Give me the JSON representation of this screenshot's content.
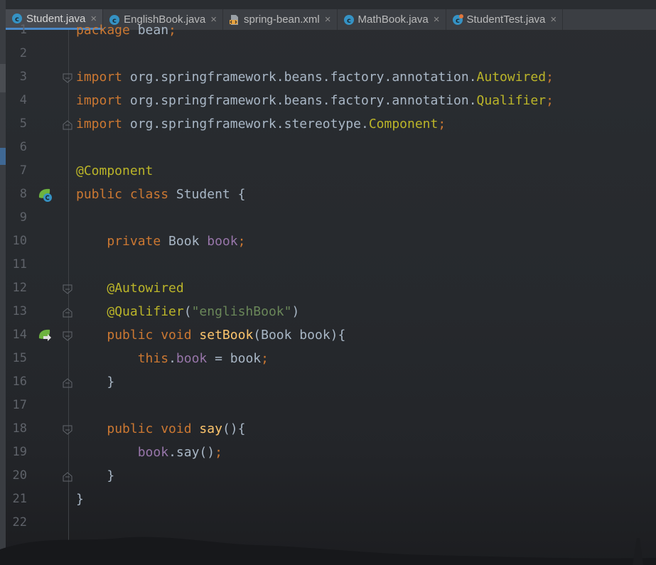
{
  "tabs": [
    {
      "label": "Student.java",
      "icon": "java-class-icon",
      "active": true
    },
    {
      "label": "EnglishBook.java",
      "icon": "java-class-icon",
      "active": false
    },
    {
      "label": "spring-bean.xml",
      "icon": "xml-file-icon",
      "active": false
    },
    {
      "label": "MathBook.java",
      "icon": "java-class-icon",
      "active": false
    },
    {
      "label": "StudentTest.java",
      "icon": "java-test-class-icon",
      "active": false
    }
  ],
  "close_glyph": "×",
  "colors": {
    "keyword": "#cc7832",
    "annotation": "#bbb529",
    "field": "#9876aa",
    "string": "#6a8759",
    "method": "#ffc66d",
    "plain": "#a9b7c6",
    "tab_active_underline": "#4a88c7"
  },
  "lines": [
    {
      "n": "1",
      "tokens": [
        [
          "kw",
          "package"
        ],
        [
          "pl",
          " bean"
        ],
        [
          "kw",
          ";"
        ]
      ]
    },
    {
      "n": "2",
      "tokens": []
    },
    {
      "n": "3",
      "tokens": [
        [
          "kw",
          "import"
        ],
        [
          "pl",
          " org.springframework.beans.factory.annotation."
        ],
        [
          "ann",
          "Autowired"
        ],
        [
          "kw",
          ";"
        ]
      ]
    },
    {
      "n": "4",
      "tokens": [
        [
          "kw",
          "import"
        ],
        [
          "pl",
          " org.springframework.beans.factory.annotation."
        ],
        [
          "ann",
          "Qualifier"
        ],
        [
          "kw",
          ";"
        ]
      ]
    },
    {
      "n": "5",
      "tokens": [
        [
          "kw",
          "import"
        ],
        [
          "pl",
          " org.springframework.stereotype."
        ],
        [
          "ann",
          "Component"
        ],
        [
          "kw",
          ";"
        ]
      ]
    },
    {
      "n": "6",
      "tokens": []
    },
    {
      "n": "7",
      "tokens": [
        [
          "ann",
          "@Component"
        ]
      ]
    },
    {
      "n": "8",
      "tokens": [
        [
          "kw",
          "public class"
        ],
        [
          "pl",
          " Student {"
        ]
      ]
    },
    {
      "n": "9",
      "tokens": []
    },
    {
      "n": "10",
      "tokens": [
        [
          "pl",
          "    "
        ],
        [
          "kw",
          "private"
        ],
        [
          "pl",
          " Book "
        ],
        [
          "fld",
          "book"
        ],
        [
          "kw",
          ";"
        ]
      ]
    },
    {
      "n": "11",
      "tokens": []
    },
    {
      "n": "12",
      "tokens": [
        [
          "pl",
          "    "
        ],
        [
          "ann",
          "@Autowired"
        ]
      ]
    },
    {
      "n": "13",
      "tokens": [
        [
          "pl",
          "    "
        ],
        [
          "ann",
          "@Qualifier"
        ],
        [
          "pl",
          "("
        ],
        [
          "str",
          "\"englishBook\""
        ],
        [
          "pl",
          ")"
        ]
      ]
    },
    {
      "n": "14",
      "tokens": [
        [
          "pl",
          "    "
        ],
        [
          "kw",
          "public void"
        ],
        [
          "pl",
          " "
        ],
        [
          "mth",
          "setBook"
        ],
        [
          "pl",
          "(Book book){"
        ]
      ]
    },
    {
      "n": "15",
      "tokens": [
        [
          "pl",
          "        "
        ],
        [
          "kw",
          "this"
        ],
        [
          "pl",
          "."
        ],
        [
          "fld",
          "book"
        ],
        [
          "pl",
          " = book"
        ],
        [
          "kw",
          ";"
        ]
      ]
    },
    {
      "n": "16",
      "tokens": [
        [
          "pl",
          "    }"
        ]
      ]
    },
    {
      "n": "17",
      "tokens": []
    },
    {
      "n": "18",
      "tokens": [
        [
          "pl",
          "    "
        ],
        [
          "kw",
          "public void"
        ],
        [
          "pl",
          " "
        ],
        [
          "mth",
          "say"
        ],
        [
          "pl",
          "(){"
        ]
      ]
    },
    {
      "n": "19",
      "tokens": [
        [
          "pl",
          "        "
        ],
        [
          "fld",
          "book"
        ],
        [
          "pl",
          ".say()"
        ],
        [
          "kw",
          ";"
        ]
      ]
    },
    {
      "n": "20",
      "tokens": [
        [
          "pl",
          "    }"
        ]
      ]
    },
    {
      "n": "21",
      "tokens": [
        [
          "pl",
          "}"
        ]
      ]
    },
    {
      "n": "22",
      "tokens": []
    }
  ],
  "gutter_markers": [
    {
      "line": "8",
      "icon": "spring-bean-class-icon"
    },
    {
      "line": "14",
      "icon": "spring-autowire-navigate-icon"
    }
  ],
  "fold_markers": [
    {
      "line": "3",
      "type": "open"
    },
    {
      "line": "5",
      "type": "close"
    },
    {
      "line": "12",
      "type": "open"
    },
    {
      "line": "13",
      "type": "close"
    },
    {
      "line": "14",
      "type": "open"
    },
    {
      "line": "16",
      "type": "close"
    },
    {
      "line": "18",
      "type": "open"
    },
    {
      "line": "20",
      "type": "close"
    }
  ]
}
